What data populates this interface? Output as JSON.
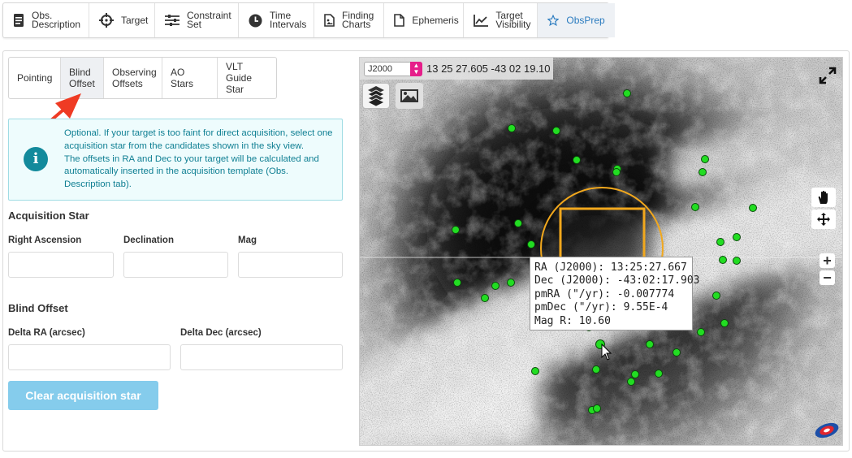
{
  "top_tabs": [
    {
      "id": "obs-description",
      "label1": "Obs.",
      "label2": "Description",
      "icon": "document-icon"
    },
    {
      "id": "target",
      "label1": "Target",
      "label2": "",
      "icon": "crosshair-icon"
    },
    {
      "id": "constraint-set",
      "label1": "Constraint",
      "label2": "Set",
      "icon": "sliders-icon"
    },
    {
      "id": "time-intervals",
      "label1": "Time",
      "label2": "Intervals",
      "icon": "clock-icon"
    },
    {
      "id": "finding-charts",
      "label1": "Finding",
      "label2": "Charts",
      "icon": "image-file-icon"
    },
    {
      "id": "ephemeris",
      "label1": "Ephemeris",
      "label2": "",
      "icon": "file-icon"
    },
    {
      "id": "target-visibility",
      "label1": "Target",
      "label2": "Visibility",
      "icon": "line-chart-icon"
    },
    {
      "id": "obsprep",
      "label1": "ObsPrep",
      "label2": "",
      "icon": "star-icon",
      "active": true
    }
  ],
  "sub_tabs": [
    {
      "label1": "Pointing",
      "label2": ""
    },
    {
      "label1": "Blind",
      "label2": "Offset",
      "active": true
    },
    {
      "label1": "Observing",
      "label2": "Offsets"
    },
    {
      "label1": "AO Stars",
      "label2": ""
    },
    {
      "label1": "VLT Guide",
      "label2": "Star"
    }
  ],
  "info": {
    "lines": [
      "Optional. If your target is too faint for direct acquisition, select one",
      "acquisition star from the candidates shown in the sky view.",
      "The offsets in RA and Dec to your target will be calculated and",
      "automatically inserted in the acquisition template (Obs.",
      "Description tab)."
    ]
  },
  "acquisition": {
    "title": "Acquisition Star",
    "ra_label": "Right Ascension",
    "dec_label": "Declination",
    "mag_label": "Mag",
    "ra_value": "",
    "dec_value": "",
    "mag_value": ""
  },
  "blind_offset": {
    "title": "Blind Offset",
    "dra_label": "Delta RA (arcsec)",
    "ddec_label": "Delta Dec (arcsec)",
    "dra_value": "",
    "ddec_value": ""
  },
  "clear_button": "Clear acquisition star",
  "sky": {
    "frame": "J2000",
    "coords": "13 25 27.605 -43 02 19.10",
    "tooltip": [
      "RA (J2000): 13:25:27.667",
      "Dec (J2000): -43:02:17.903",
      "pmRA (\"/yr): -0.007774",
      "pmDec (\"/yr): 9.55E-4",
      "Mag R: 10.60"
    ]
  },
  "colors": {
    "accent": "#2a7bbf",
    "info_bg": "#eefcfd",
    "info_text": "#0f7f93",
    "button": "#85ccec",
    "star_marker": "#22dd22",
    "fov": "#f2a81d",
    "arrow": "#ef3b24"
  }
}
